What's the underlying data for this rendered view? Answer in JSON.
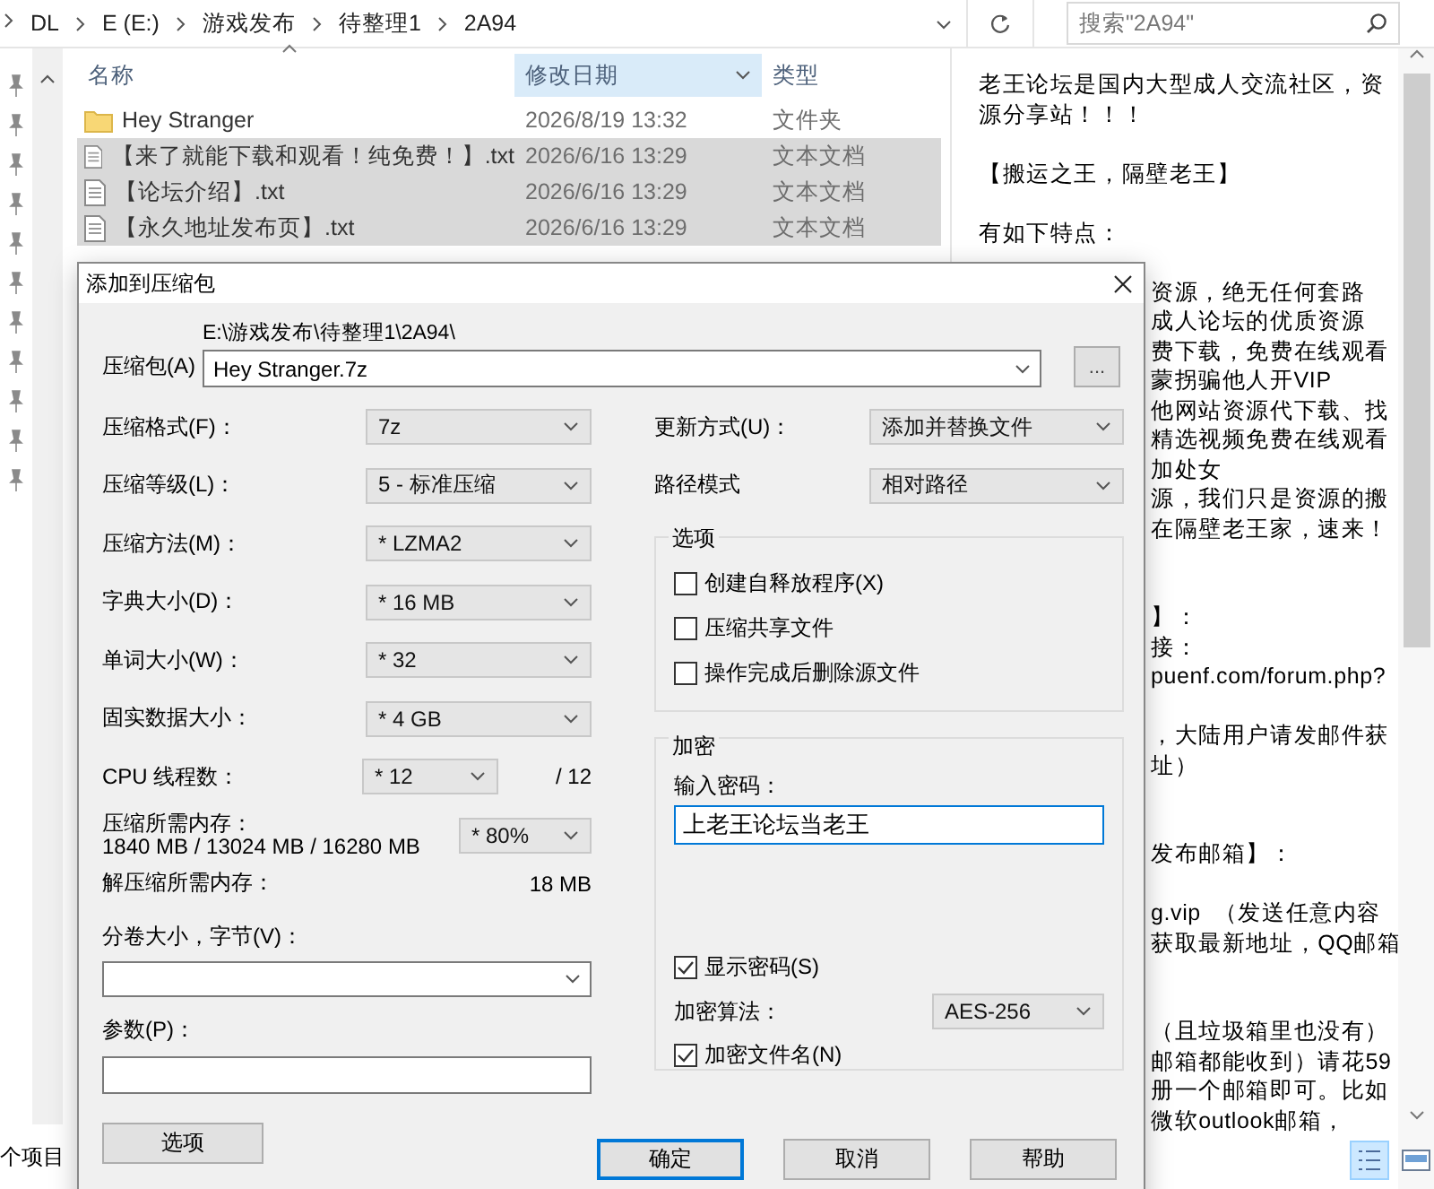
{
  "explorer": {
    "breadcrumb": [
      "DL",
      "E (E:)",
      "游戏发布",
      "待整理1",
      "2A94"
    ],
    "search": {
      "placeholder": "搜索\"2A94\""
    },
    "columns": [
      {
        "label": "名称",
        "sorted": true,
        "hovered": false
      },
      {
        "label": "修改日期",
        "sorted": false,
        "hovered": true
      },
      {
        "label": "类型",
        "sorted": false,
        "hovered": false
      }
    ],
    "files": [
      {
        "kind": "folder",
        "name": "Hey Stranger",
        "date": "2026/8/19 13:32",
        "type": "文件夹",
        "selected": false
      },
      {
        "kind": "text",
        "name": "【来了就能下载和观看！纯免费！】.txt",
        "date": "2026/6/16 13:29",
        "type": "文本文档",
        "selected": true
      },
      {
        "kind": "text",
        "name": "【论坛介绍】.txt",
        "date": "2026/6/16 13:29",
        "type": "文本文档",
        "selected": true
      },
      {
        "kind": "text",
        "name": "【永久地址发布页】.txt",
        "date": "2026/6/16 13:29",
        "type": "文本文档",
        "selected": true
      }
    ],
    "status": "个项目"
  },
  "preview": {
    "blocks": [
      {
        "kind": "full",
        "wide_gap": false,
        "lines": [
          "老王论坛是国内大型成人交流社区，资",
          "源分享站！！！"
        ]
      },
      {
        "kind": "full",
        "wide_gap": false,
        "lines": [
          "【搬运之王，隔壁老王】"
        ]
      },
      {
        "kind": "full",
        "wide_gap": false,
        "lines": [
          "有如下特点："
        ]
      },
      {
        "kind": "clipped",
        "wide_gap": true,
        "lines": [
          "资源，绝无任何套路",
          "成人论坛的优质资源",
          "费下载，免费在线观看",
          "蒙拐骗他人开VIP",
          "他网站资源代下载、找",
          "精选视频免费在线观看",
          "加处女",
          "源，我们只是资源的搬",
          "在隔壁老王家，速来！"
        ]
      },
      {
        "kind": "clipped",
        "wide_gap": false,
        "lines": [
          "】：",
          "接：",
          "puenf.com/forum.php?"
        ]
      },
      {
        "kind": "clipped",
        "wide_gap": true,
        "lines": [
          "，大陆用户请发邮件获",
          "址）"
        ]
      },
      {
        "kind": "clipped",
        "wide_gap": false,
        "lines": [
          "发布邮箱】："
        ]
      },
      {
        "kind": "clipped",
        "wide_gap": true,
        "lines": [
          "g.vip  （发送任意内容",
          "获取最新地址，QQ邮箱"
        ]
      },
      {
        "kind": "clipped",
        "wide_gap": false,
        "lines": [
          "（且垃圾箱里也没有）",
          "邮箱都能收到）请花59",
          "册一个邮箱即可。比如",
          "微软outlook邮箱，"
        ]
      }
    ]
  },
  "dialog": {
    "title": "添加到压缩包",
    "archive_label": "压缩包(A)",
    "archive_path": "E:\\游戏发布\\待整理1\\2A94\\",
    "archive_name": "Hey Stranger.7z",
    "browse": "...",
    "settings": [
      {
        "label": "压缩格式(F)：",
        "value": "7z"
      },
      {
        "label": "压缩等级(L)：",
        "value": "5 - 标准压缩"
      },
      {
        "label": "压缩方法(M)：",
        "value": "* LZMA2"
      },
      {
        "label": "字典大小(D)：",
        "value": "* 16 MB"
      },
      {
        "label": "单词大小(W)：",
        "value": "* 32"
      },
      {
        "label": "固实数据大小：",
        "value": "* 4 GB"
      }
    ],
    "cpu": {
      "label": "CPU 线程数：",
      "value": "* 12",
      "max": "/ 12"
    },
    "memory": {
      "label": "压缩所需内存：",
      "detail": "1840 MB / 13024 MB / 16280 MB",
      "value": "* 80%"
    },
    "decompress": {
      "label": "解压缩所需内存：",
      "value": "18 MB"
    },
    "volume": {
      "label": "分卷大小，字节(V)："
    },
    "params": {
      "label": "参数(P)："
    },
    "options_button": "选项",
    "update": {
      "label": "更新方式(U)：",
      "value": "添加并替换文件"
    },
    "path_mode": {
      "label": "路径模式",
      "value": "相对路径"
    },
    "options_group": {
      "title": "选项",
      "items": [
        {
          "label": "创建自释放程序(X)",
          "checked": false
        },
        {
          "label": "压缩共享文件",
          "checked": false
        },
        {
          "label": "操作完成后删除源文件",
          "checked": false
        }
      ]
    },
    "encryption": {
      "title": "加密",
      "password_label": "输入密码：",
      "password": "上老王论坛当老王",
      "show_password": {
        "label": "显示密码(S)",
        "checked": true
      },
      "method": {
        "label": "加密算法：",
        "value": "AES-256"
      },
      "encrypt_names": {
        "label": "加密文件名(N)",
        "checked": true
      }
    },
    "buttons": [
      "确定",
      "取消",
      "帮助"
    ]
  }
}
